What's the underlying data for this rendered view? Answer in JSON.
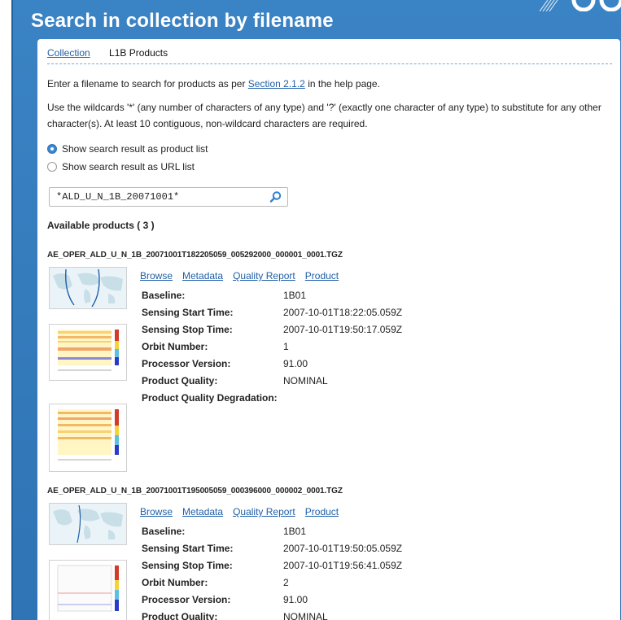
{
  "page": {
    "title": "Search in collection by filename"
  },
  "breadcrumb": {
    "collection": "Collection",
    "current": "L1B Products"
  },
  "intro": {
    "before": "Enter a filename to search for products as per ",
    "link": "Section 2.1.2",
    "after": " in the help page."
  },
  "wildcard_text": "Use the wildcards '*' (any number of characters of any type) and '?' (exactly one character of any type) to substitute for any other character(s). At least 10 contiguous, non-wildcard characters are required.",
  "options": {
    "product_list": "Show search result as product list",
    "url_list": "Show search result as URL list",
    "selected": "product_list"
  },
  "search": {
    "value": "*ALD_U_N_1B_20071001*"
  },
  "available_label": "Available products ( 3 )",
  "action_links": {
    "browse": "Browse",
    "metadata": "Metadata",
    "quality_report": "Quality Report",
    "product": "Product"
  },
  "field_labels": {
    "baseline": "Baseline:",
    "start": "Sensing Start Time:",
    "stop": "Sensing Stop Time:",
    "orbit": "Orbit Number:",
    "processor": "Processor Version:",
    "quality": "Product Quality:",
    "degradation": "Product Quality Degradation:"
  },
  "products": [
    {
      "name": "AE_OPER_ALD_U_N_1B_20071001T182205059_005292000_000001_0001.TGZ",
      "baseline": "1B01",
      "start": "2007-10-01T18:22:05.059Z",
      "stop": "2007-10-01T19:50:17.059Z",
      "orbit": "1",
      "processor": "91.00",
      "quality": "NOMINAL",
      "degradation": ""
    },
    {
      "name": "AE_OPER_ALD_U_N_1B_20071001T195005059_000396000_000002_0001.TGZ",
      "baseline": "1B01",
      "start": "2007-10-01T19:50:05.059Z",
      "stop": "2007-10-01T19:56:41.059Z",
      "orbit": "2",
      "processor": "91.00",
      "quality": "NOMINAL"
    }
  ]
}
